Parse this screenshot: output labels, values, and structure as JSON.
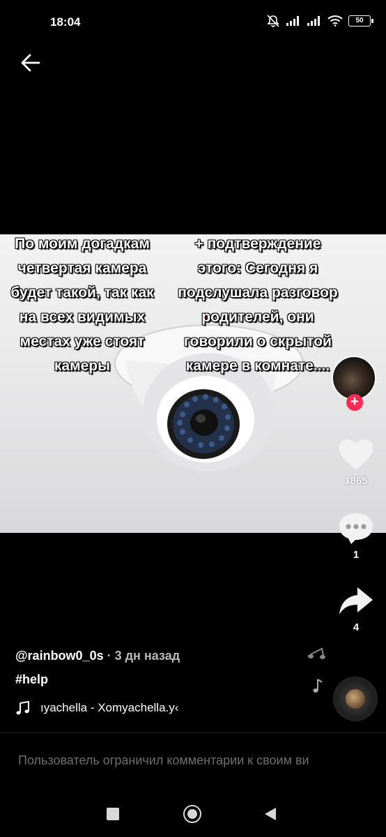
{
  "status_bar": {
    "time": "18:04",
    "battery": "50",
    "icons": [
      "mute-bell-icon",
      "signal-icon",
      "signal-icon",
      "wifi-icon",
      "battery-icon"
    ]
  },
  "video": {
    "overlay_left": [
      "По моим догадкам",
      "четвертая камера",
      "будет такой, так как",
      "на всех видимых",
      "местах уже стоят",
      "камеры"
    ],
    "overlay_right": [
      "+ подтверждение",
      "этого: Сегодня я",
      "подслушала разговор",
      "родителей, они",
      "говорили о скрытой",
      "камере в комнате...."
    ]
  },
  "actions": {
    "like_count": "1865",
    "comment_count": "1",
    "share_count": "4",
    "follow_symbol": "+"
  },
  "meta": {
    "author": "@rainbow0_0s",
    "separator": " · ",
    "time_ago": "3 дн назад",
    "caption": "#help",
    "music": "ıyachella - Xomyachella.y‹"
  },
  "comment_bar": {
    "placeholder": "Пользователь ограничил комментарии к своим ви"
  },
  "colors": {
    "accent": "#fe2c55",
    "background": "#000000"
  }
}
